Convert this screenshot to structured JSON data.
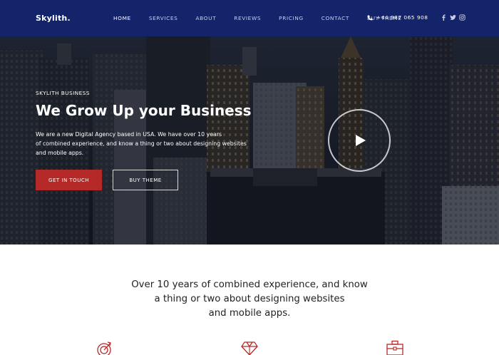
{
  "brand": {
    "logo": "Skylith."
  },
  "nav": {
    "items": [
      {
        "label": "HOME",
        "active": true
      },
      {
        "label": "SERVICES",
        "active": false
      },
      {
        "label": "ABOUT",
        "active": false
      },
      {
        "label": "REVIEWS",
        "active": false
      },
      {
        "label": "PRICING",
        "active": false
      },
      {
        "label": "CONTACT",
        "active": false
      },
      {
        "label": "BUY THEME",
        "active": false
      }
    ],
    "phone": "+44 987 065 908",
    "phone_icon": "phone-icon",
    "socials": [
      "facebook-icon",
      "twitter-icon",
      "instagram-icon"
    ]
  },
  "hero": {
    "eyebrow": "SKYLITH BUSINESS",
    "title": "We Grow Up your Business",
    "description_lines": [
      "We are a new Digital Agency based in USA. We have over 10 years",
      "of combined experience, and know a thing or two about designing websites",
      "and mobile apps."
    ],
    "primary_button": "GET IN TOUCH",
    "secondary_button": "BUY THEME",
    "play_icon": "play-icon"
  },
  "intro": {
    "lines": [
      "Over 10 years of combined experience, and know",
      "a thing or two about designing websites",
      "and mobile apps."
    ]
  },
  "features": {
    "icons": [
      "target-arrow-icon",
      "diamond-icon",
      "briefcase-icon"
    ]
  },
  "colors": {
    "navbar": "#14246b",
    "accent": "#b52a28",
    "text": "#222222"
  }
}
